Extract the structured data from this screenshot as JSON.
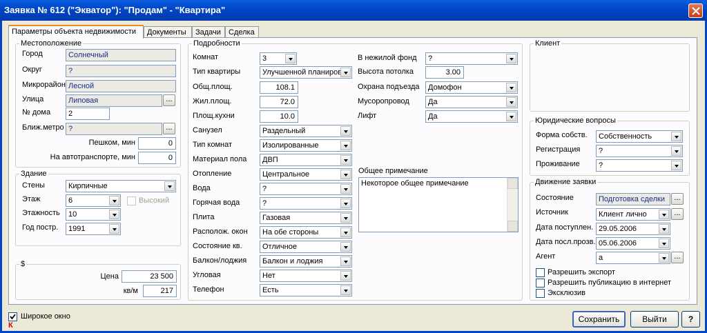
{
  "window": {
    "title": "Заявка № 612 (\"Экватор\"): \"Продам\" - \"Квартира\""
  },
  "tabs": [
    "Параметры объекта недвижимости",
    "Документы",
    "Задачи",
    "Сделка"
  ],
  "location": {
    "title": "Местоположение",
    "city_label": "Город",
    "city": "Солнечный",
    "district_label": "Округ",
    "district": "?",
    "microdistrict_label": "Микрорайон",
    "microdistrict": "Лесной",
    "street_label": "Улица",
    "street": "Липовая",
    "house_label": "№ дома",
    "house": "2",
    "metro_label": "Ближ.метро",
    "metro": "?",
    "walk_label": "Пешком, мин",
    "walk": "0",
    "transport_label": "На автотранспорте, мин",
    "transport": "0"
  },
  "building": {
    "title": "Здание",
    "walls_label": "Стены",
    "walls": "Кирпичные",
    "floor_label": "Этаж",
    "floor": "6",
    "high_label": "Высокий",
    "floors_label": "Этажность",
    "floors": "10",
    "year_label": "Год постр.",
    "year": "1991"
  },
  "price": {
    "title": "$",
    "price_label": "Цена",
    "price": "23 500",
    "sqm_label": "кв/м",
    "sqm": "217"
  },
  "details": {
    "title": "Подробности",
    "rows": [
      {
        "label": "Комнат",
        "value": "3"
      },
      {
        "label": "Тип квартиры",
        "value": "Улучшенной планиров"
      },
      {
        "label": "Общ.площ.",
        "value": "108.1"
      },
      {
        "label": "Жил.площ.",
        "value": "72.0"
      },
      {
        "label": "Площ.кухни",
        "value": "10.0"
      },
      {
        "label": "Санузел",
        "value": "Раздельный"
      },
      {
        "label": "Тип комнат",
        "value": "Изолированные"
      },
      {
        "label": "Материал пола",
        "value": "ДВП"
      },
      {
        "label": "Отопление",
        "value": "Центральное"
      },
      {
        "label": "Вода",
        "value": "?"
      },
      {
        "label": "Горячая вода",
        "value": "?"
      },
      {
        "label": "Плита",
        "value": "Газовая"
      },
      {
        "label": "Располож. окон",
        "value": "На обе стороны"
      },
      {
        "label": "Состояние кв.",
        "value": "Отличное"
      },
      {
        "label": "Балкон/лоджия",
        "value": "Балкон и лоджия"
      },
      {
        "label": "Угловая",
        "value": "Нет"
      },
      {
        "label": "Телефон",
        "value": "Есть"
      }
    ],
    "right": [
      {
        "label": "В нежилой фонд",
        "value": "?"
      },
      {
        "label": "Высота потолка",
        "value": "3.00"
      },
      {
        "label": "Охрана подъезда",
        "value": "Домофон"
      },
      {
        "label": "Мусоропровод",
        "value": "Да"
      },
      {
        "label": "Лифт",
        "value": "Да"
      }
    ],
    "note_label": "Общее примечание",
    "note": "Некоторое общее примечание"
  },
  "client": {
    "title": "Клиент"
  },
  "legal": {
    "title": "Юридические вопросы",
    "rows": [
      {
        "label": "Форма собств.",
        "value": "Собственность"
      },
      {
        "label": "Регистрация",
        "value": "?"
      },
      {
        "label": "Проживание",
        "value": "?"
      }
    ]
  },
  "flow": {
    "title": "Движение заявки",
    "status_label": "Состояние",
    "status": "Подготовка сделки",
    "source_label": "Источник",
    "source": "Клиент лично",
    "date_in_label": "Дата поступлен.",
    "date_in": "29.05.2006",
    "date_last_label": "Дата посл.прозв.",
    "date_last": "05.06.2006",
    "agent_label": "Агент",
    "agent": "а",
    "checks": [
      "Разрешить экспорт",
      "Разрешить публикацию в интернет",
      "Эксклюзив"
    ]
  },
  "footer": {
    "wide_label": "Широкое окно",
    "k_mark": "К",
    "save": "Сохранить",
    "exit": "Выйти",
    "help": "?"
  }
}
